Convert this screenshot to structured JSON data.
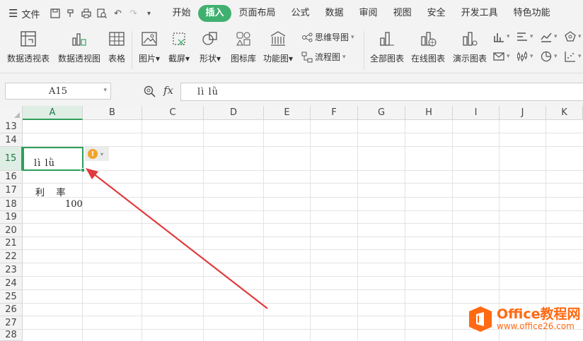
{
  "menubar": {
    "file_label": "文件",
    "tabs": [
      "开始",
      "插入",
      "页面布局",
      "公式",
      "数据",
      "审阅",
      "视图",
      "安全",
      "开发工具",
      "特色功能"
    ],
    "active_tab": "插入"
  },
  "ribbon": {
    "pivot_table": "数据透视表",
    "pivot_chart": "数据透视图",
    "table": "表格",
    "picture": "图片",
    "screenshot": "截屏",
    "shape": "形状",
    "icon_lib": "图标库",
    "func_chart": "功能图",
    "mindmap": "思维导图",
    "flowchart": "流程图",
    "all_charts": "全部图表",
    "online_charts": "在线图表",
    "demo_charts": "演示图表"
  },
  "formula_bar": {
    "name_box": "A15",
    "fx_label": "fx",
    "value": "lì  lǜ"
  },
  "sheet": {
    "columns": [
      "A",
      "B",
      "C",
      "D",
      "E",
      "F",
      "G",
      "H",
      "I",
      "J",
      "K"
    ],
    "selected_column": "A",
    "rows": [
      "13",
      "14",
      "15",
      "16",
      "17",
      "18",
      "19",
      "20",
      "21",
      "22",
      "23",
      "24",
      "25",
      "26",
      "27",
      "28"
    ],
    "selected_row": "15",
    "cell_a15": "lì  lǜ",
    "cell_a17": "利    率",
    "cell_a18": "100"
  },
  "watermark": {
    "brand": "Office教程网",
    "url": "www.office26.com"
  },
  "colors": {
    "accent": "#3fb06f",
    "selection": "#2e9e5a",
    "annotation_arrow": "#e03a3e",
    "warning": "#f0a52a",
    "watermark": "#ff6a13"
  }
}
